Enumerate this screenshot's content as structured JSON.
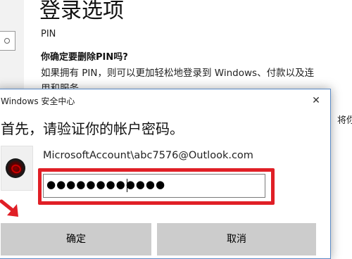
{
  "settings": {
    "title": "登录选项",
    "pin_label": "PIN",
    "confirm_question": "你确定要删除PIN吗?",
    "description_line1": "如果拥有 PIN，则可以更加轻松地登录到 Windows、付款以及连",
    "description_line2": "用和服务。",
    "side_text": "将你"
  },
  "dialog": {
    "title": "Windows 安全中心",
    "close_glyph": "✕",
    "heading": "首先，请验证你的帐户密码。",
    "account": "MicrosoftAccount\\abc7576@Outlook.com",
    "password_value": "●●●●●●●●●●●●",
    "ok_label": "确定",
    "cancel_label": "取消"
  },
  "annotation": {
    "highlight_color": "#e01f26"
  }
}
